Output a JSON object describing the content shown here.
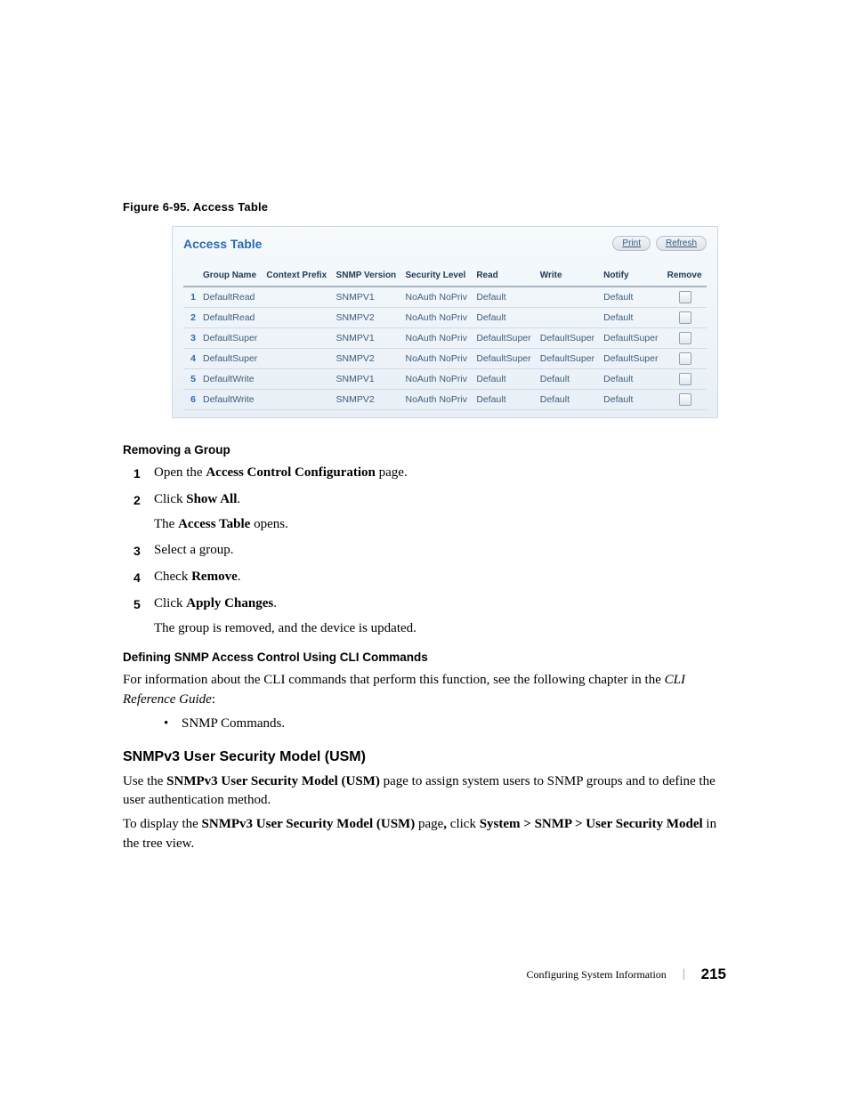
{
  "figure_caption": "Figure 6-95.    Access Table",
  "screenshot": {
    "title": "Access Table",
    "buttons": {
      "print": "Print",
      "refresh": "Refresh"
    },
    "headers": [
      "Group Name",
      "Context Prefix",
      "SNMP Version",
      "Security Level",
      "Read",
      "Write",
      "Notify",
      "Remove"
    ],
    "rows": [
      {
        "n": "1",
        "group": "DefaultRead",
        "context": "",
        "version": "SNMPV1",
        "security": "NoAuth NoPriv",
        "read": "Default",
        "write": "",
        "notify": "Default"
      },
      {
        "n": "2",
        "group": "DefaultRead",
        "context": "",
        "version": "SNMPV2",
        "security": "NoAuth NoPriv",
        "read": "Default",
        "write": "",
        "notify": "Default"
      },
      {
        "n": "3",
        "group": "DefaultSuper",
        "context": "",
        "version": "SNMPV1",
        "security": "NoAuth NoPriv",
        "read": "DefaultSuper",
        "write": "DefaultSuper",
        "notify": "DefaultSuper"
      },
      {
        "n": "4",
        "group": "DefaultSuper",
        "context": "",
        "version": "SNMPV2",
        "security": "NoAuth NoPriv",
        "read": "DefaultSuper",
        "write": "DefaultSuper",
        "notify": "DefaultSuper"
      },
      {
        "n": "5",
        "group": "DefaultWrite",
        "context": "",
        "version": "SNMPV1",
        "security": "NoAuth NoPriv",
        "read": "Default",
        "write": "Default",
        "notify": "Default"
      },
      {
        "n": "6",
        "group": "DefaultWrite",
        "context": "",
        "version": "SNMPV2",
        "security": "NoAuth NoPriv",
        "read": "Default",
        "write": "Default",
        "notify": "Default"
      }
    ]
  },
  "removing_group_heading": "Removing a Group",
  "steps": {
    "s1_a": "Open the ",
    "s1_b": "Access Control Configuration",
    "s1_c": " page.",
    "s2_a": "Click ",
    "s2_b": "Show All",
    "s2_c": ".",
    "s2_sub_a": "The ",
    "s2_sub_b": "Access Table",
    "s2_sub_c": " opens.",
    "s3": "Select a group.",
    "s4_a": "Check ",
    "s4_b": "Remove",
    "s4_c": ".",
    "s5_a": "Click ",
    "s5_b": "Apply Changes",
    "s5_c": ".",
    "s5_sub": "The group is removed, and the device is updated."
  },
  "cli_heading": "Defining SNMP Access Control Using CLI Commands",
  "cli_para_a": "For information about the CLI commands that perform this function, see the following chapter in the ",
  "cli_para_b": "CLI Reference Guide",
  "cli_para_c": ":",
  "cli_bullet": "SNMP Commands.",
  "usm_heading": "SNMPv3 User Security Model (USM)",
  "usm_p1_a": "Use the ",
  "usm_p1_b": "SNMPv3 User Security Model (USM)",
  "usm_p1_c": " page to assign system users to SNMP groups and to define the user authentication method.",
  "usm_p2_a": "To display the ",
  "usm_p2_b": "SNMPv3 User Security Model (USM)",
  "usm_p2_c": " page",
  "usm_p2_d": ", ",
  "usm_p2_e": "click ",
  "usm_p2_f": "System > SNMP > User Security Model",
  "usm_p2_g": " in the tree view.",
  "footer_text": "Configuring System Information",
  "page_number": "215"
}
